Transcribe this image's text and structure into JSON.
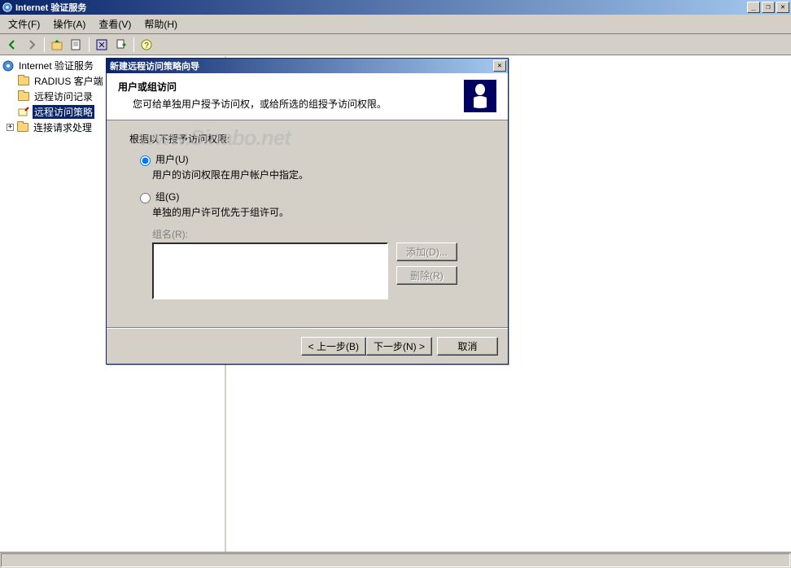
{
  "window": {
    "title": "Internet 验证服务"
  },
  "menu": {
    "file": "文件(F)",
    "action": "操作(A)",
    "view": "查看(V)",
    "help": "帮助(H)"
  },
  "tree": {
    "root": "Internet 验证服务",
    "items": [
      "RADIUS 客户端",
      "远程访问记录",
      "远程访问策略",
      "连接请求处理"
    ]
  },
  "wizard": {
    "title": "新建远程访问策略向导",
    "header_title": "用户或组访问",
    "header_desc": "您可给单独用户授予访问权，或给所选的组授予访问权限。",
    "section": "根据以下授予访问权限:",
    "user_label": "用户(U)",
    "user_desc": "用户的访问权限在用户帐户中指定。",
    "group_label": "组(G)",
    "group_desc": "单独的用户许可优先于组许可。",
    "group_name": "组名(R):",
    "add_btn": "添加(D)...",
    "remove_btn": "删除(R)",
    "back_btn": "< 上一步(B)",
    "next_btn": "下一步(N) >",
    "cancel_btn": "取消"
  },
  "watermark": "www.Sinabo.net"
}
